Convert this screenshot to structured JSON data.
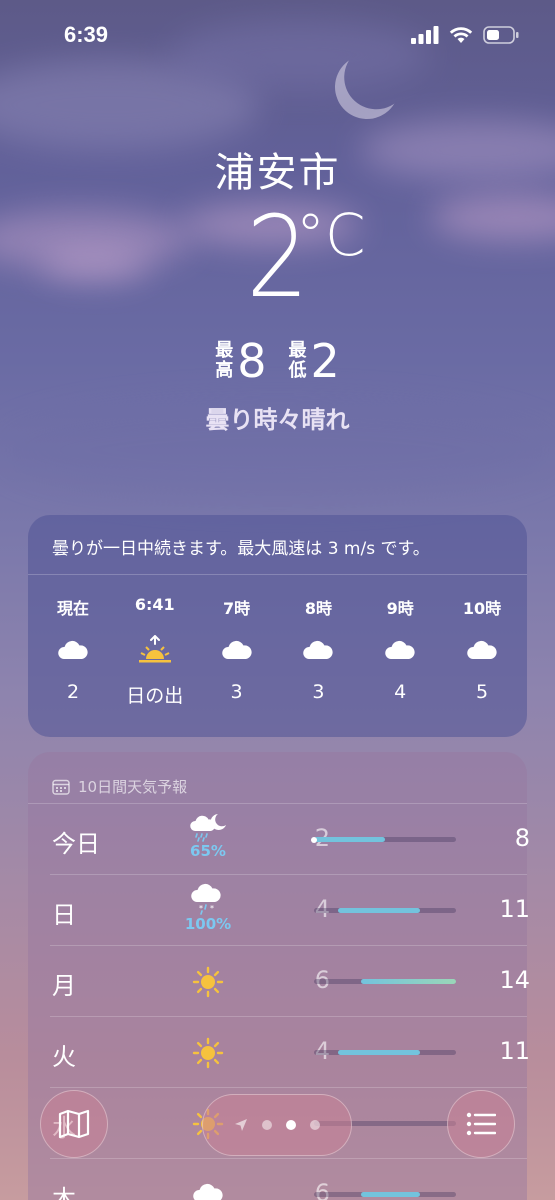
{
  "status": {
    "time": "6:39"
  },
  "location": {
    "city": "浦安市",
    "temp": "2",
    "unit": "°C",
    "high_label_1": "最",
    "high_label_2": "高",
    "high": "8",
    "low_label_1": "最",
    "low_label_2": "低",
    "low": "2",
    "condition": "曇り時々晴れ"
  },
  "hourly": {
    "summary": "曇りが一日中続きます。最大風速は 3 m/s です。",
    "items": [
      {
        "label": "現在",
        "icon": "cloud-icon",
        "temp": "2"
      },
      {
        "label": "6:41",
        "icon": "sunrise-icon",
        "temp": "日の出"
      },
      {
        "label": "7時",
        "icon": "cloud-icon",
        "temp": "3"
      },
      {
        "label": "8時",
        "icon": "cloud-icon",
        "temp": "3"
      },
      {
        "label": "9時",
        "icon": "cloud-icon",
        "temp": "4"
      },
      {
        "label": "10時",
        "icon": "cloud-icon",
        "temp": "5"
      }
    ]
  },
  "forecast": {
    "title": "10日間天気予報",
    "range": [
      2,
      14
    ],
    "days": [
      {
        "day": "今日",
        "icon": "rain-moon-cloud-icon",
        "pop": "65%",
        "low": "2",
        "high": "8",
        "current": 2
      },
      {
        "day": "日",
        "icon": "snow-rain-cloud-icon",
        "pop": "100%",
        "low": "4",
        "high": "11"
      },
      {
        "day": "月",
        "icon": "sun-icon",
        "pop": "",
        "low": "6",
        "high": "14"
      },
      {
        "day": "火",
        "icon": "sun-icon",
        "pop": "",
        "low": "4",
        "high": "11"
      },
      {
        "day": "水",
        "icon": "sun-icon",
        "pop": "",
        "low": "",
        "high": ""
      },
      {
        "day": "木",
        "icon": "cloud-icon",
        "pop": "",
        "low": "6",
        "high": ""
      }
    ]
  },
  "colors": {
    "bar_fill": "#73c3dd",
    "bar_fill_warm": "#9ad6b8",
    "pop": "#7cc8f0",
    "sun": "#f6c23e"
  },
  "nav": {
    "pages": 3,
    "active_page": 2
  }
}
